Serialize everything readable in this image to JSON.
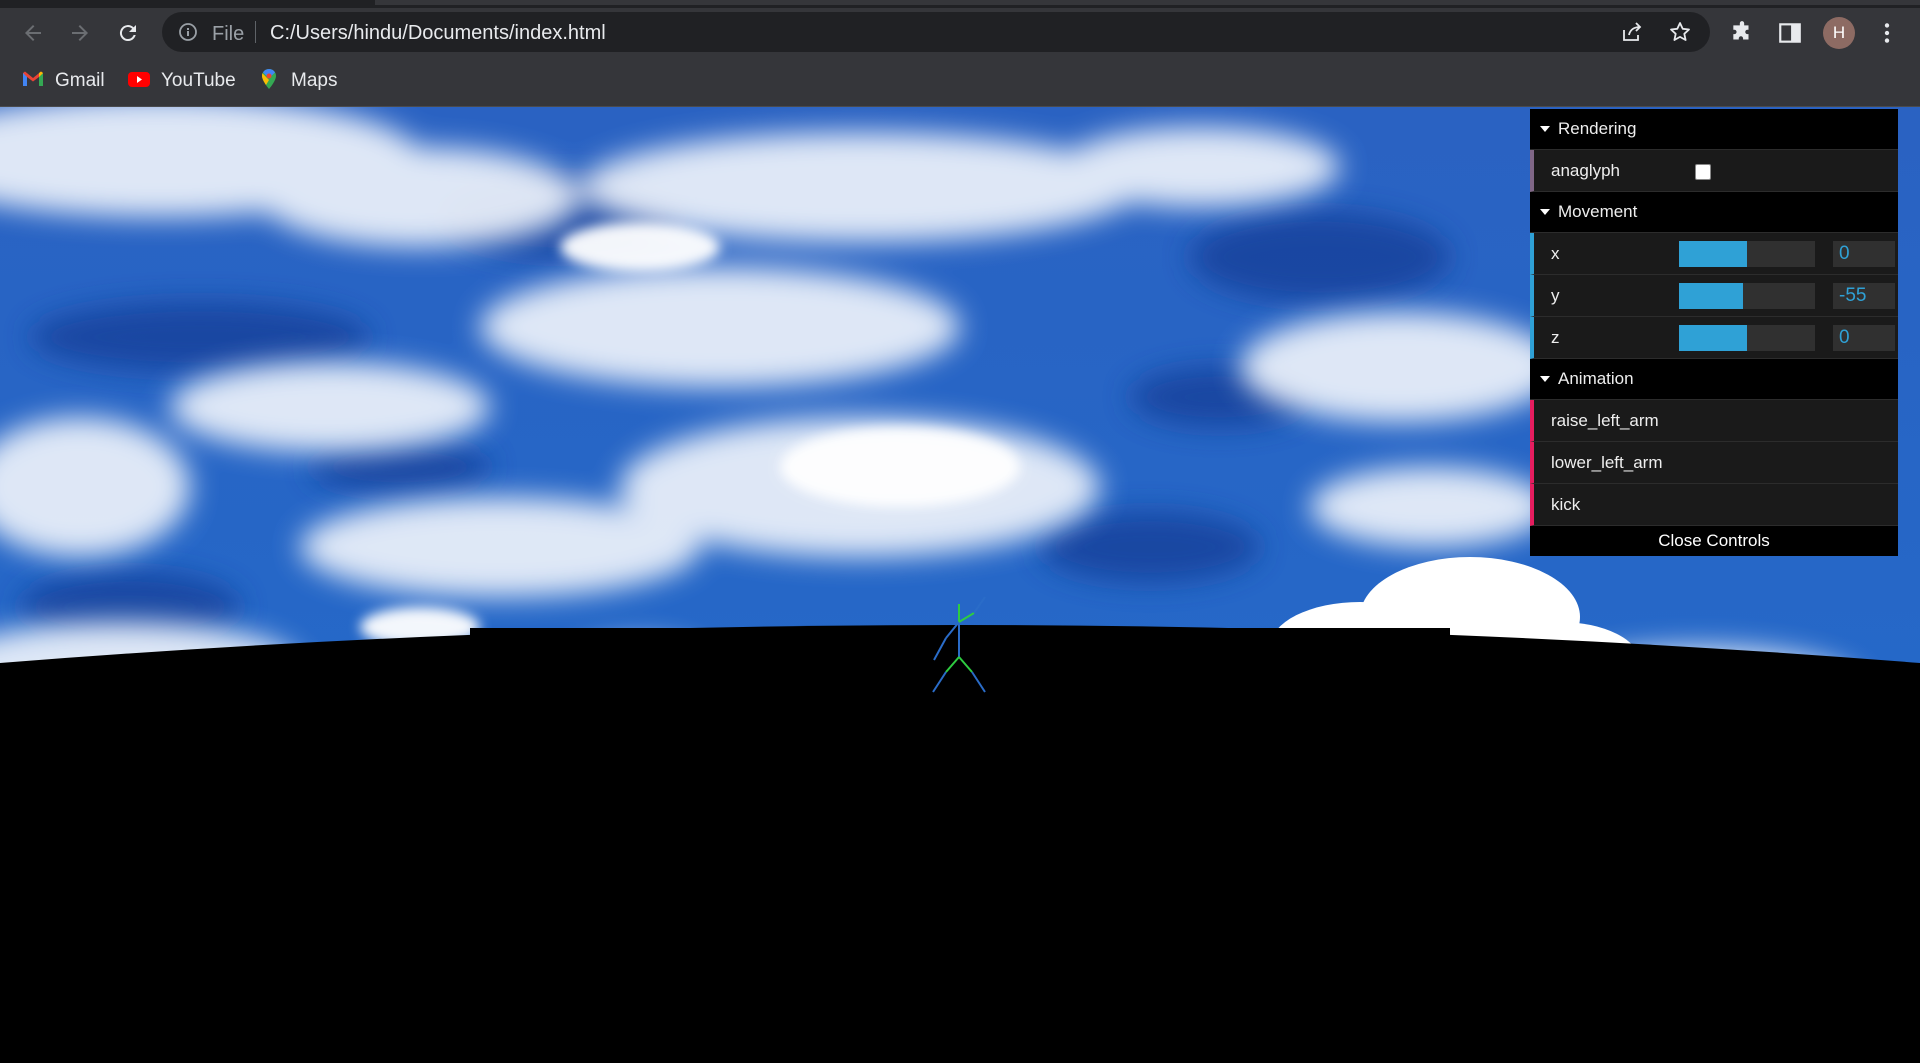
{
  "browser": {
    "omnibox": {
      "file_label": "File",
      "url": "C:/Users/hindu/Documents/index.html"
    },
    "avatar_letter": "H",
    "bookmarks": [
      {
        "label": "Gmail",
        "icon": "gmail-icon"
      },
      {
        "label": "YouTube",
        "icon": "youtube-icon"
      },
      {
        "label": "Maps",
        "icon": "maps-icon"
      }
    ],
    "icons": [
      "back-arrow-icon",
      "forward-arrow-icon",
      "reload-icon",
      "info-icon",
      "share-icon",
      "star-icon",
      "extensions-icon",
      "side-panel-icon",
      "kebab-menu-icon"
    ]
  },
  "scene": {
    "sky_colors": {
      "deep": "#1747a8",
      "mid": "#3a78d0",
      "cloud": "#ffffff"
    },
    "ground_color": "#000000",
    "figure_colors": {
      "bones_blue": "#2a6cc8",
      "bones_green": "#2ecc40"
    }
  },
  "gui": {
    "folders": [
      {
        "title": "Rendering",
        "controls": [
          {
            "name": "anaglyph",
            "type": "boolean",
            "checked": false
          }
        ]
      },
      {
        "title": "Movement",
        "controls": [
          {
            "name": "x",
            "type": "number",
            "value": "0",
            "fill": 0.5
          },
          {
            "name": "y",
            "type": "number",
            "value": "-55",
            "fill": 0.47
          },
          {
            "name": "z",
            "type": "number",
            "value": "0",
            "fill": 0.5
          }
        ]
      },
      {
        "title": "Animation",
        "controls": [
          {
            "name": "raise_left_arm",
            "type": "function"
          },
          {
            "name": "lower_left_arm",
            "type": "function"
          },
          {
            "name": "kick",
            "type": "function"
          }
        ]
      }
    ],
    "close_label": "Close Controls",
    "colors": {
      "number": "#2fa1d6",
      "boolean": "#806787",
      "function": "#e61d5f"
    }
  }
}
